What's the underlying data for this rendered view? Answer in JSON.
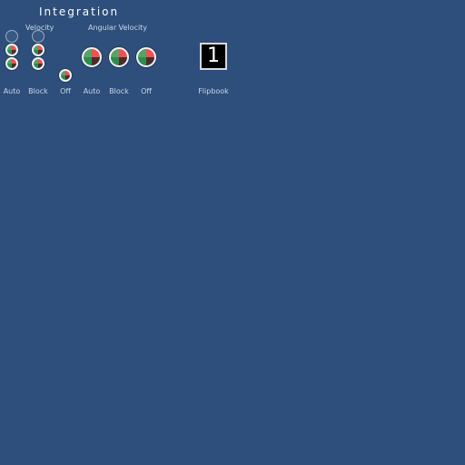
{
  "panel": {
    "title": "Integration",
    "velocity_label": "Velocity",
    "angular_velocity_label": "Angular Velocity"
  },
  "modes": {
    "velocity": {
      "auto": "Auto",
      "block": "Block",
      "off": "Off"
    },
    "angular_velocity": {
      "auto": "Auto",
      "block": "Block",
      "off": "Off"
    }
  },
  "flipbook": {
    "value": "1",
    "label": "Flipbook"
  },
  "colors": {
    "background": "#2e4e7b",
    "knob_red": "#f05050",
    "knob_green": "#2c8e4a",
    "knob_dark_red": "#4e2b2b",
    "knob_light_green": "#5aa06b"
  },
  "icons": {
    "velocity_knob": "velocity-dial-icon",
    "angular_velocity_knob": "angular-velocity-dial-icon"
  }
}
